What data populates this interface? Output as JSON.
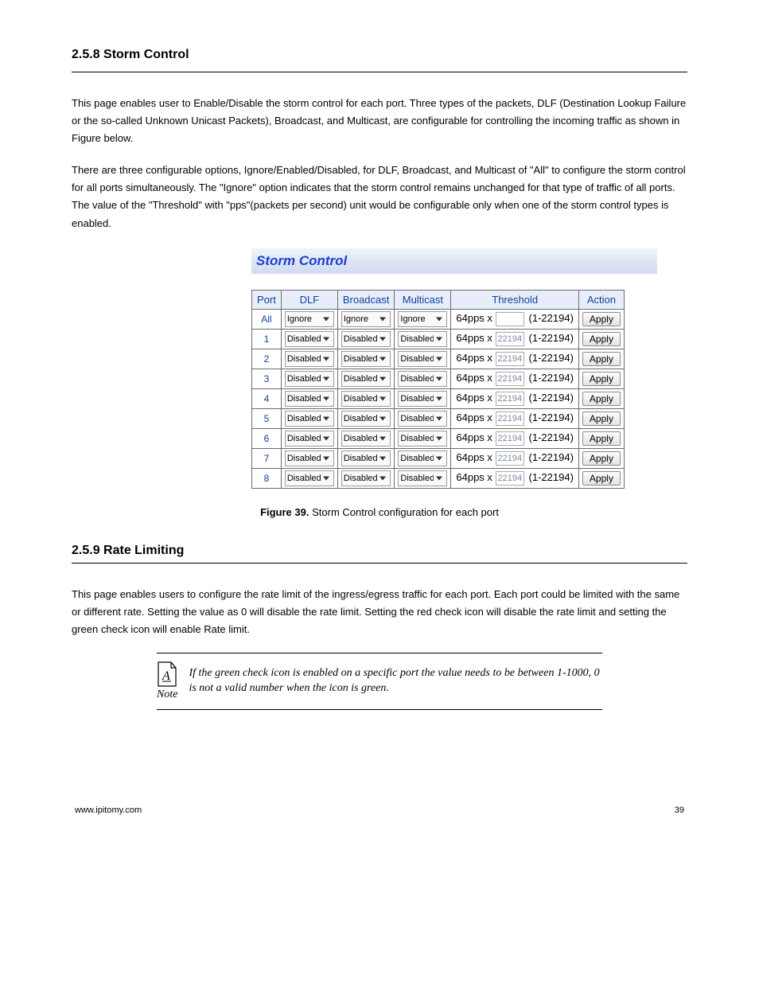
{
  "section": {
    "number": "2.5.8 Storm Control",
    "para1": "This page enables user to Enable/Disable the storm control for each port. Three types of the packets, DLF (Destination Lookup Failure or the so-called Unknown Unicast Packets), Broadcast, and Multicast, are configurable for controlling the incoming traffic as shown in Figure below.",
    "para2": "There are three configurable options, Ignore/Enabled/Disabled, for DLF, Broadcast, and Multicast of \"All\" to configure the storm control for all ports simultaneously. The \"Ignore\" option indicates that the storm control remains unchanged for that type of traffic of all ports. The value of the \"Threshold\" with \"pps\"(packets per second) unit would be configurable only when one of the storm control types is enabled."
  },
  "panel": {
    "title": "Storm Control"
  },
  "table": {
    "headers": [
      "Port",
      "DLF",
      "Broadcast",
      "Multicast",
      "Threshold",
      "Action"
    ],
    "all_row": {
      "port": "All",
      "dlf": "Ignore",
      "broadcast": "Ignore",
      "multicast": "Ignore",
      "thresh_prefix": "64pps x",
      "thresh_value": "",
      "thresh_range": "(1-22194)",
      "apply": "Apply"
    },
    "rows": [
      {
        "port": "1",
        "dlf": "Disabled",
        "broadcast": "Disabled",
        "multicast": "Disabled",
        "thresh_prefix": "64pps x",
        "thresh_value": "22194",
        "thresh_range": "(1-22194)",
        "apply": "Apply"
      },
      {
        "port": "2",
        "dlf": "Disabled",
        "broadcast": "Disabled",
        "multicast": "Disabled",
        "thresh_prefix": "64pps x",
        "thresh_value": "22194",
        "thresh_range": "(1-22194)",
        "apply": "Apply"
      },
      {
        "port": "3",
        "dlf": "Disabled",
        "broadcast": "Disabled",
        "multicast": "Disabled",
        "thresh_prefix": "64pps x",
        "thresh_value": "22194",
        "thresh_range": "(1-22194)",
        "apply": "Apply"
      },
      {
        "port": "4",
        "dlf": "Disabled",
        "broadcast": "Disabled",
        "multicast": "Disabled",
        "thresh_prefix": "64pps x",
        "thresh_value": "22194",
        "thresh_range": "(1-22194)",
        "apply": "Apply"
      },
      {
        "port": "5",
        "dlf": "Disabled",
        "broadcast": "Disabled",
        "multicast": "Disabled",
        "thresh_prefix": "64pps x",
        "thresh_value": "22194",
        "thresh_range": "(1-22194)",
        "apply": "Apply"
      },
      {
        "port": "6",
        "dlf": "Disabled",
        "broadcast": "Disabled",
        "multicast": "Disabled",
        "thresh_prefix": "64pps x",
        "thresh_value": "22194",
        "thresh_range": "(1-22194)",
        "apply": "Apply"
      },
      {
        "port": "7",
        "dlf": "Disabled",
        "broadcast": "Disabled",
        "multicast": "Disabled",
        "thresh_prefix": "64pps x",
        "thresh_value": "22194",
        "thresh_range": "(1-22194)",
        "apply": "Apply"
      },
      {
        "port": "8",
        "dlf": "Disabled",
        "broadcast": "Disabled",
        "multicast": "Disabled",
        "thresh_prefix": "64pps x",
        "thresh_value": "22194",
        "thresh_range": "(1-22194)",
        "apply": "Apply"
      }
    ]
  },
  "figure": {
    "label": "Figure 39.",
    "text": " Storm Control configuration for each port"
  },
  "rate": {
    "heading": "2.5.9 Rate Limiting",
    "body": "This page enables users to configure the rate limit of the ingress/egress traffic for each port. Each port could be limited with the same or different rate. Setting the value as 0 will disable the rate limit. Setting the red check icon will disable the rate limit and setting the green check icon will enable Rate limit."
  },
  "note": {
    "label": "Note",
    "text": "If the green check icon is enabled on a specific port the value needs to be between 1-1000, 0 is not a valid number when the icon is green."
  },
  "footer": {
    "left": "www.ipitomy.com",
    "right": "39"
  }
}
